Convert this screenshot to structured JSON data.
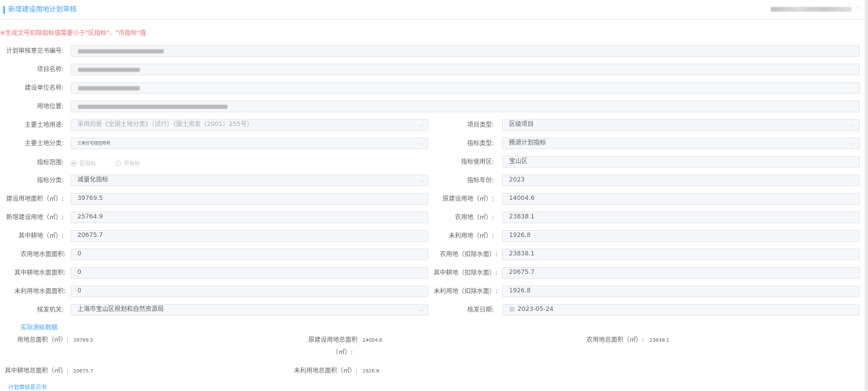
{
  "header": {
    "title": "新增建设用地计划审核"
  },
  "notice": "※生成文号扣除指标值需要小于\"区指标\"、\"市指标\"值",
  "form": {
    "opinion_no_label": "计划审核意见书编号:",
    "project_name_label": "项目名称:",
    "builder_label": "建设单位名称:",
    "location_label": "用地位置:",
    "land_use_label": "主要土地用途:",
    "land_use_value": "采用的是《全国土地分类》（试行）（国土资发〔2001〕255号）",
    "land_class_label": "主要土地分类:",
    "land_class_value": "三类住宅组团用地",
    "index_range_label": "指标范围:",
    "index_range_options": [
      "区指标",
      "市指标"
    ],
    "index_category_label": "指标分类:",
    "index_category_value": "减量化指标",
    "build_area_label": "建设用地面积（㎡）:",
    "build_area_value": "39769.5",
    "new_build_label": "新增建设用地（㎡）:",
    "new_build_value": "25764.9",
    "farmland_label": "其中耕地（㎡）:",
    "farmland_value": "20675.7",
    "agri_water_label": "农用地水面面积:",
    "agri_water_value": "0",
    "farm_water_label": "其中耕地水面面积:",
    "farm_water_value": "0",
    "unused_water_label": "未利用地水面面积:",
    "unused_water_value": "0",
    "issuer_label": "核发机关:",
    "issuer_value": "上海市宝山区规划和自然资源局",
    "project_type_label": "项目类型:",
    "project_type_value": "区级项目",
    "index_type_label": "指标类型:",
    "index_type_value": "腾退计划指标",
    "use_district_label": "指标使用区:",
    "use_district_value": "宝山区",
    "year_label": "指标年份:",
    "year_value": "2023",
    "orig_build_label": "原建设用地（㎡）:",
    "orig_build_value": "14004.6",
    "agri_label": "农用地（㎡）:",
    "agri_value": "23838.1",
    "unused_label": "未利用地（㎡）:",
    "unused_value": "1926.8",
    "agri_ex_label": "农用地（扣除水面）:",
    "agri_ex_value": "23838.1",
    "farm_ex_label": "其中耕地（扣除水面）:",
    "farm_ex_value": "20675.7",
    "unused_ex_label": "未利用地（扣除水面）:",
    "unused_ex_value": "1926.8",
    "issue_date_label": "核发日期:",
    "issue_date_value": "2023-05-24"
  },
  "survey": {
    "section_title": "实际测绘数据",
    "total_land_label": "用地总面积（㎡）:",
    "total_land_value": "39769.5",
    "orig_total_label": "原建设用地总面积",
    "orig_total_unit": "（㎡）:",
    "orig_total_value": "14004.6",
    "agri_total_label": "农用地总面积（㎡）:",
    "agri_total_value": "23838.1",
    "farm_total_label": "其中耕地总面积（㎡）:",
    "farm_total_value": "20675.7",
    "unused_total_label": "未利用地总面积（㎡）:",
    "unused_total_value": "1926.8"
  },
  "footer": {
    "opinion_section": "计划审核意见书"
  },
  "icons": {
    "dropdown": "chevron-down-icon",
    "calendar": "calendar-icon"
  },
  "colors": {
    "accent": "#409eff",
    "warning": "#f56c6c"
  }
}
